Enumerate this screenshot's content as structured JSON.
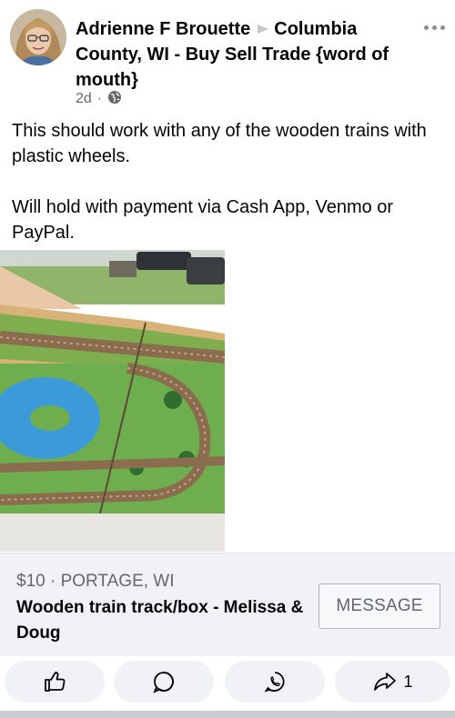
{
  "post": {
    "author": "Adrienne F Brouette",
    "group": "Columbia County, WI - Buy Sell Trade {word of mouth}",
    "time": "2d",
    "privacy_icon": "globe-icon",
    "body_paragraphs": [
      "This should work with any of the wooden trains with plastic wheels.",
      "Will hold with payment via Cash App, Venmo or PayPal."
    ]
  },
  "listing": {
    "price_location": "$10 · PORTAGE, WI",
    "title": "Wooden train track/box - Melissa & Doug",
    "message_label": "MESSAGE"
  },
  "actions": {
    "like_icon": "thumbs-up-icon",
    "comment_icon": "comment-bubble-icon",
    "whatsapp_icon": "whatsapp-icon",
    "share_icon": "share-arrow-icon",
    "share_count": "1"
  },
  "colors": {
    "text": "#050505",
    "secondary": "#65676b",
    "listing_bg": "#f0f2f5"
  }
}
